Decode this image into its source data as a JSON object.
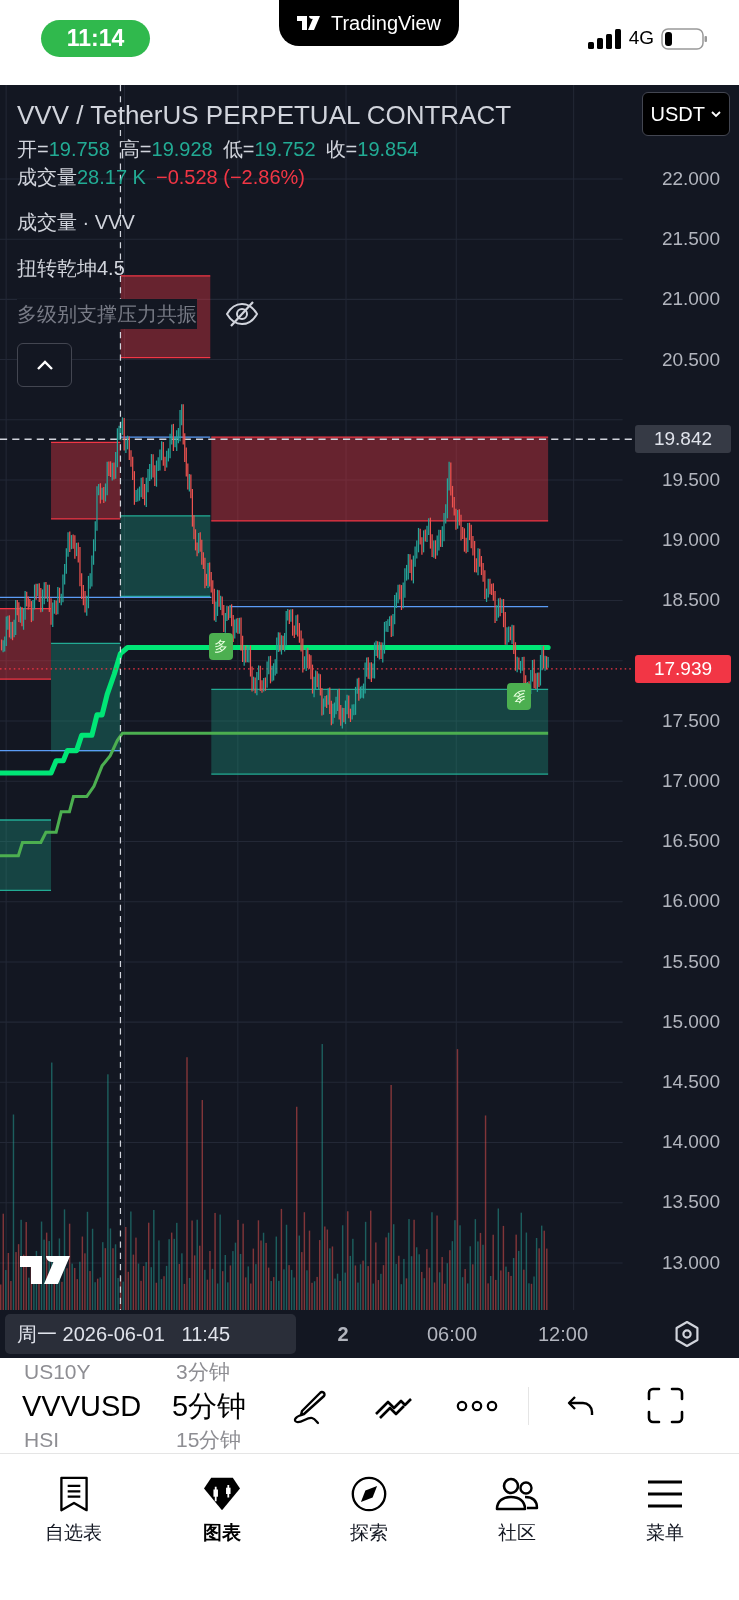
{
  "status_bar": {
    "time": "11:14",
    "app": "TradingView",
    "network": "4G"
  },
  "chart": {
    "symbol_title": "VVV / TetherUS PERPETUAL CONTRACT",
    "currency_button": "USDT",
    "ohlc": [
      {
        "label": "开=",
        "value": "19.758"
      },
      {
        "label": "高=",
        "value": "19.928"
      },
      {
        "label": "低=",
        "value": "19.752"
      },
      {
        "label": "收=",
        "value": "19.854"
      }
    ],
    "volume": {
      "label": "成交量",
      "value": "28.17 K"
    },
    "change": "−0.528 (−2.86%)",
    "indicators": [
      {
        "name": "成交量 · VVV",
        "visible": true
      },
      {
        "name": "扭转乾坤4.5",
        "visible": true
      },
      {
        "name": "多级别支撑压力共振",
        "visible": false
      }
    ],
    "price_axis": [
      "22.000",
      "21.500",
      "21.000",
      "20.500",
      "19.500",
      "19.000",
      "18.500",
      "17.500",
      "17.000",
      "16.500",
      "16.000",
      "15.500",
      "15.000",
      "14.500",
      "14.000",
      "13.500",
      "13.000"
    ],
    "last_price": "19.842",
    "current_price": "17.939",
    "signals": [
      "多",
      "多"
    ],
    "time_axis": {
      "crosshair_label": "周一 2026-06-01   11:45",
      "ticks": [
        "2",
        "06:00",
        "12:00"
      ]
    }
  },
  "toolbar": {
    "picker_above": [
      "US10Y",
      "3分钟"
    ],
    "symbol": "VVVUSD",
    "interval": "5分钟",
    "picker_below": [
      "HSI",
      "15分钟"
    ]
  },
  "tabs": [
    {
      "label": "自选表",
      "selected": false
    },
    {
      "label": "图表",
      "selected": true
    },
    {
      "label": "探索",
      "selected": false
    },
    {
      "label": "社区",
      "selected": false
    },
    {
      "label": "菜单",
      "selected": false
    }
  ]
}
